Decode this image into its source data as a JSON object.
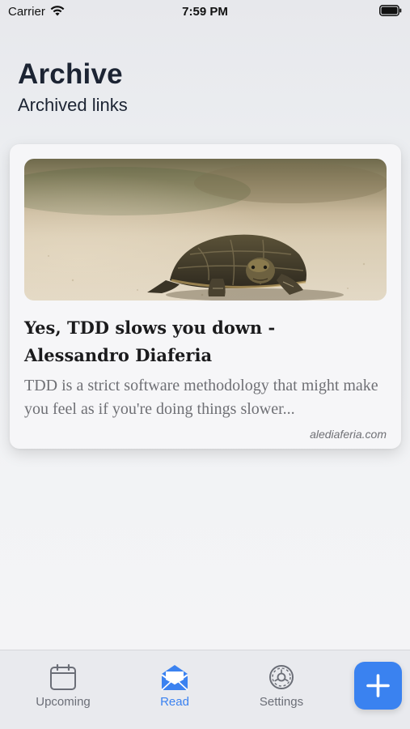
{
  "status_bar": {
    "carrier": "Carrier",
    "time": "7:59 PM",
    "icons": [
      "wifi-icon",
      "battery-icon"
    ]
  },
  "header": {
    "title": "Archive",
    "subtitle": "Archived links"
  },
  "links": [
    {
      "image": "turtle-photo",
      "title": "Yes, TDD slows you down - Alessandro Diaferia",
      "excerpt": "TDD is a strict software methodology that might make you feel as if you're doing things slower...",
      "domain": "alediaferia.com"
    }
  ],
  "tab_bar": {
    "tabs": [
      {
        "label": "Upcoming",
        "icon": "calendar-icon",
        "active": false
      },
      {
        "label": "Read",
        "icon": "envelope-open-icon",
        "active": true
      },
      {
        "label": "Settings",
        "icon": "gear-icon",
        "active": false
      }
    ],
    "add_button_icon": "plus-icon"
  },
  "colors": {
    "accent": "#3a82f0",
    "inactive_tab": "#6b6e77",
    "title_text": "#1c2433",
    "muted_text": "#6f7075"
  }
}
